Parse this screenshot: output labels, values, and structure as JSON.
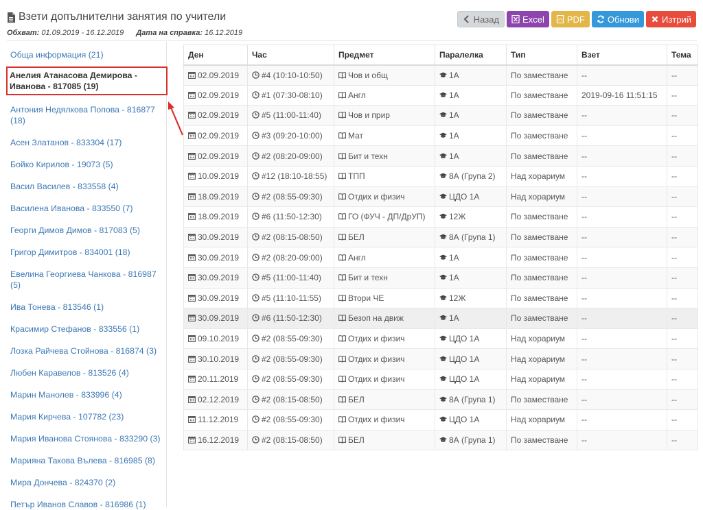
{
  "header": {
    "title": "Взети допълнителни занятия по учители",
    "scope_label": "Обхват:",
    "scope_value": "01.09.2019 - 16.12.2019",
    "date_label": "Дата на справка:",
    "date_value": "16.12.2019"
  },
  "toolbar": {
    "back": "Назад",
    "excel": "Excel",
    "pdf": "PDF",
    "refresh": "Обнови",
    "delete": "Изтрий"
  },
  "colors": {
    "excel": "#8e44ad",
    "pdf": "#e3b649",
    "refresh": "#3498db",
    "delete": "#e74c3c",
    "link": "#3b78b5",
    "highlight_border": "#d9312b"
  },
  "sidebar": {
    "items": [
      {
        "label": "Обща информация (21)"
      },
      {
        "label": "Анелия Атанасова Демирова - Иванова - 817085 (19)",
        "active": true
      },
      {
        "label": "Антония Недялкова Попова - 816877 (18)"
      },
      {
        "label": "Асен Златанов - 833304 (17)"
      },
      {
        "label": "Бойко Кирилов - 19073 (5)"
      },
      {
        "label": "Васил Василев - 833558 (4)"
      },
      {
        "label": "Василена Иванова - 833550 (7)"
      },
      {
        "label": "Георги Димов Димов - 817083 (5)"
      },
      {
        "label": "Григор Димитров - 834001 (18)"
      },
      {
        "label": "Евелина Георгиева Чанкова - 816987 (5)"
      },
      {
        "label": "Ива Тонева - 813546 (1)"
      },
      {
        "label": "Красимир Стефанов - 833556 (1)"
      },
      {
        "label": "Лозка Райчева Стойнова - 816874 (3)"
      },
      {
        "label": "Любен Каравелов - 813526 (4)"
      },
      {
        "label": "Марин Манолев - 833996 (4)"
      },
      {
        "label": "Мария Кирчева - 107782 (23)"
      },
      {
        "label": "Мария Иванова Стоянова - 833290 (3)"
      },
      {
        "label": "Марияна Такова Вълева - 816985 (8)"
      },
      {
        "label": "Мира Дончева - 824370 (2)"
      },
      {
        "label": "Петър Иванов Славов - 816986 (1)"
      }
    ]
  },
  "table": {
    "columns": [
      "Ден",
      "Час",
      "Предмет",
      "Паралелка",
      "Тип",
      "Взет",
      "Тема"
    ],
    "rows": [
      [
        "02.09.2019",
        "#4 (10:10-10:50)",
        "Чов и общ",
        "1А",
        "По заместване",
        "--",
        "--"
      ],
      [
        "02.09.2019",
        "#1 (07:30-08:10)",
        "Англ",
        "1А",
        "По заместване",
        "2019-09-16 11:51:15",
        "--"
      ],
      [
        "02.09.2019",
        "#5 (11:00-11:40)",
        "Чов и прир",
        "1А",
        "По заместване",
        "--",
        "--"
      ],
      [
        "02.09.2019",
        "#3 (09:20-10:00)",
        "Мат",
        "1А",
        "По заместване",
        "--",
        "--"
      ],
      [
        "02.09.2019",
        "#2 (08:20-09:00)",
        "Бит и техн",
        "1А",
        "По заместване",
        "--",
        "--"
      ],
      [
        "10.09.2019",
        "#12 (18:10-18:55)",
        "ТПП",
        "8А (Група 2)",
        "Над хорариум",
        "--",
        "--"
      ],
      [
        "18.09.2019",
        "#2 (08:55-09:30)",
        "Отдих и физич",
        "ЦДО 1А",
        "Над хорариум",
        "--",
        "--"
      ],
      [
        "18.09.2019",
        "#6 (11:50-12:30)",
        "ГО (ФУЧ - ДП/ДрУП)",
        "12Ж",
        "По заместване",
        "--",
        "--"
      ],
      [
        "30.09.2019",
        "#2 (08:15-08:50)",
        "БЕЛ",
        "8А (Група 1)",
        "По заместване",
        "--",
        "--"
      ],
      [
        "30.09.2019",
        "#2 (08:20-09:00)",
        "Англ",
        "1А",
        "По заместване",
        "--",
        "--"
      ],
      [
        "30.09.2019",
        "#5 (11:00-11:40)",
        "Бит и техн",
        "1А",
        "По заместване",
        "--",
        "--"
      ],
      [
        "30.09.2019",
        "#5 (11:10-11:55)",
        "Втори ЧЕ",
        "12Ж",
        "По заместване",
        "--",
        "--"
      ],
      [
        "30.09.2019",
        "#6 (11:50-12:30)",
        "Безоп на движ",
        "1А",
        "По заместване",
        "--",
        "--"
      ],
      [
        "09.10.2019",
        "#2 (08:55-09:30)",
        "Отдих и физич",
        "ЦДО 1А",
        "Над хорариум",
        "--",
        "--"
      ],
      [
        "30.10.2019",
        "#2 (08:55-09:30)",
        "Отдих и физич",
        "ЦДО 1А",
        "Над хорариум",
        "--",
        "--"
      ],
      [
        "20.11.2019",
        "#2 (08:55-09:30)",
        "Отдих и физич",
        "ЦДО 1А",
        "Над хорариум",
        "--",
        "--"
      ],
      [
        "02.12.2019",
        "#2 (08:15-08:50)",
        "БЕЛ",
        "8А (Група 1)",
        "По заместване",
        "--",
        "--"
      ],
      [
        "11.12.2019",
        "#2 (08:55-09:30)",
        "Отдих и физич",
        "ЦДО 1А",
        "Над хорариум",
        "--",
        "--"
      ],
      [
        "16.12.2019",
        "#2 (08:15-08:50)",
        "БЕЛ",
        "8А (Група 1)",
        "По заместване",
        "--",
        "--"
      ]
    ]
  }
}
